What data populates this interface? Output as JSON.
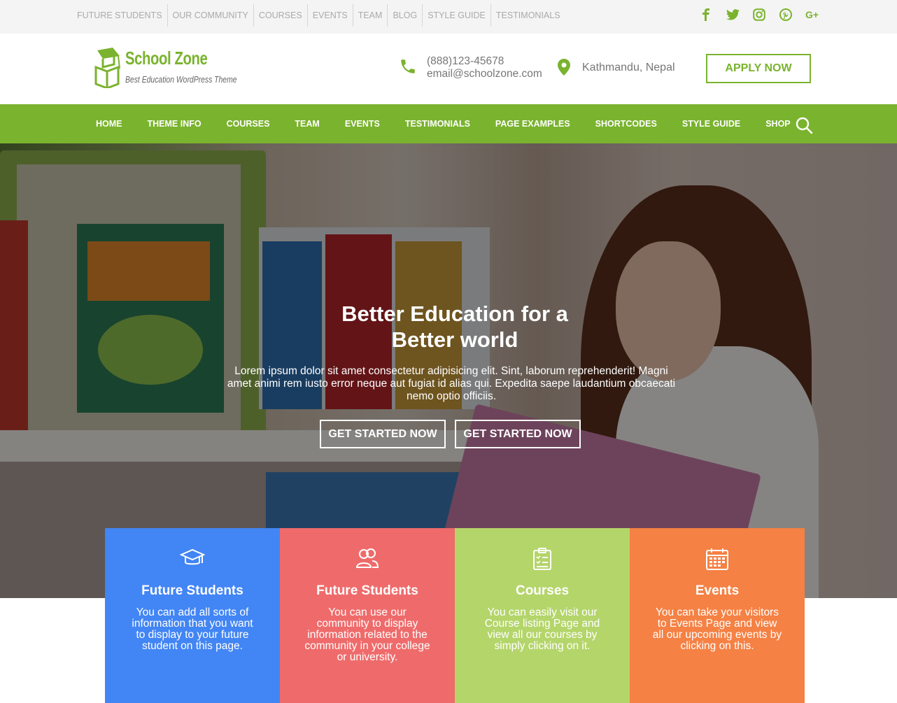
{
  "topbar": {
    "links": [
      "FUTURE STUDENTS",
      "OUR COMMUNITY",
      "COURSES",
      "EVENTS",
      "TEAM",
      "BLOG",
      "STYLE GUIDE",
      "TESTIMONIALS"
    ],
    "social_icons": [
      "facebook-icon",
      "twitter-icon",
      "instagram-icon",
      "pinterest-icon",
      "google-plus-icon"
    ],
    "social_color": "#7ab32e"
  },
  "header": {
    "logo_title": "School Zone",
    "logo_tagline": "Best Education WordPress Theme",
    "phone": "(888)123-45678",
    "email": "email@schoolzone.com",
    "location": "Kathmandu, Nepal",
    "apply_label": "APPLY NOW"
  },
  "nav": {
    "items": [
      "HOME",
      "THEME INFO",
      "COURSES",
      "TEAM",
      "EVENTS",
      "TESTIMONIALS",
      "PAGE EXAMPLES",
      "SHORTCODES",
      "STYLE GUIDE",
      "SHOP"
    ],
    "background": "#7ab32e",
    "search_icon": "search-icon"
  },
  "hero": {
    "title_line1": "Better Education for a",
    "title_line2": "Better world",
    "text": "Lorem ipsum dolor sit amet consectetur adipisicing elit. Sint, laborum reprehenderit! Magni amet animi rem iusto error neque aut fugiat id alias qui. Expedita saepe laudantium obcaecati nemo optio officiis.",
    "button1_label": "GET STARTED NOW",
    "button2_label": "GET STARTED NOW"
  },
  "features": [
    {
      "icon": "graduation-cap-icon",
      "title": "Future Students",
      "text": "You can add all sorts of information that you want to display to your future student on this page.",
      "color": "#4285f4"
    },
    {
      "icon": "users-icon",
      "title": "Future Students",
      "text": "You can use our community to display information related to the community in your college or university.",
      "color": "#ef6b6b"
    },
    {
      "icon": "clipboard-icon",
      "title": "Courses",
      "text": "You can easily visit our Course listing Page and view all our courses by simply clicking on it.",
      "color": "#b4d56a"
    },
    {
      "icon": "calendar-icon",
      "title": "Events",
      "text": "You can take your visitors to Events Page and view all our upcoming events by clicking on this.",
      "color": "#f58144"
    }
  ]
}
